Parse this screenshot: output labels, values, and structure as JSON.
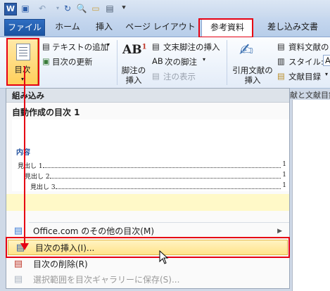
{
  "qat": {
    "logo": "W",
    "icons": [
      "save-icon",
      "undo-icon",
      "redo-icon",
      "print-preview-icon",
      "open-icon",
      "new-icon",
      "customize-icon"
    ]
  },
  "tabs": [
    "ファイル",
    "ホーム",
    "挿入",
    "ページ レイアウト",
    "参考資料",
    "差し込み文書"
  ],
  "ribbon": {
    "toc_button": "目次",
    "add_text": "テキストの追加",
    "update_toc": "目次の更新",
    "footnote_insert": "脚注の挿入",
    "footnote_label_1": "脚注の",
    "footnote_label_2": "挿入",
    "endnote_insert": "文末脚注の挿入",
    "next_footnote": "次の脚注",
    "show_notes": "注の表示",
    "citation_label_1": "引用文献の",
    "citation_label_2": "挿入",
    "manage_sources": "資料文献の",
    "style_label": "スタイル:",
    "style_value": "A",
    "bibliography": "文献目録",
    "behind_text": "献と文献目録"
  },
  "menu": {
    "header": "組み込み",
    "gallery_title": "自動作成の目次 1",
    "preview_heading": "内容",
    "toc_lines": [
      {
        "text": "見出し 1",
        "page": "1"
      },
      {
        "text": "見出し 2",
        "page": "1"
      },
      {
        "text": "見出し 3",
        "page": "1"
      }
    ],
    "items": {
      "more": "Office.com のその他の目次(M)",
      "insert": "目次の挿入(I)...",
      "remove": "目次の削除(R)",
      "save": "選択範囲を目次ギャラリーに保存(S)..."
    }
  },
  "colors": {
    "highlight": "#e60012",
    "file_tab": "#1b54a2",
    "hover": "#ffe38a"
  }
}
